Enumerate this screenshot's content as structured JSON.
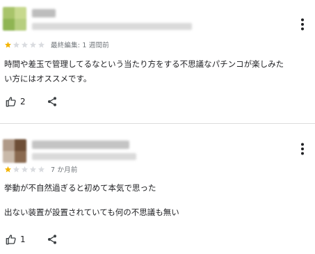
{
  "reviews": [
    {
      "rating": 1,
      "max_rating": 5,
      "meta": "最終編集: 1 週間前",
      "text_lines": [
        "時間や差玉で管理してるなという当たり方をする不思議なパチンコが楽しみた",
        "い方にはオススメです。"
      ],
      "like_count": "2"
    },
    {
      "rating": 1,
      "max_rating": 5,
      "meta": "7 か月前",
      "text_lines": [
        "挙動が不自然過ぎると初めて本気で思った",
        "出ない装置が設置されていても何の不思議も無い"
      ],
      "like_count": "1"
    }
  ],
  "colors": {
    "star_filled": "#f4b400",
    "star_empty": "#dadce0",
    "icon": "#3c4043",
    "divider": "#dcdcdc"
  },
  "icons": {
    "menu": "more-vert-icon",
    "like": "thumb-up-icon",
    "share": "share-icon",
    "star": "star-icon"
  }
}
